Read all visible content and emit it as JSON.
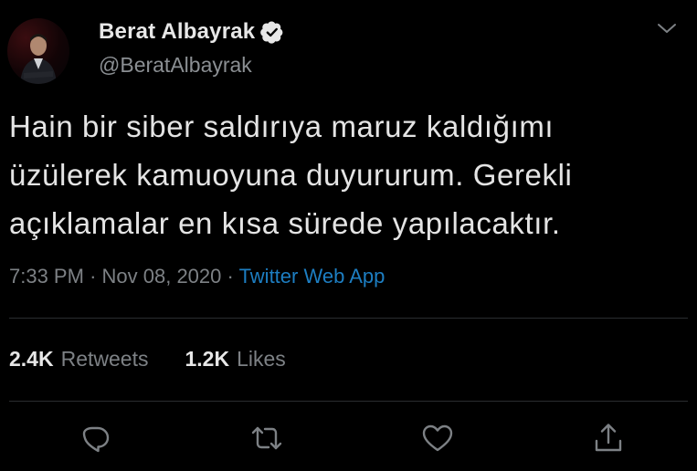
{
  "author": {
    "display_name": "Berat Albayrak",
    "handle": "@BeratAlbayrak",
    "verified": true
  },
  "tweet": {
    "text_lines": [
      "Hain bir siber saldırıya maruz kaldığımı",
      "üzülerek kamuoyuna duyururum. Gerekli",
      "açıklamalar en kısa sürede yapılacaktır."
    ]
  },
  "meta": {
    "time": "7:33 PM",
    "separator": "·",
    "date": "Nov 08, 2020",
    "source": "Twitter Web App"
  },
  "stats": {
    "retweets_count": "2.4K",
    "retweets_label": "Retweets",
    "likes_count": "1.2K",
    "likes_label": "Likes"
  },
  "icons": {
    "verified": "verified-badge-icon",
    "menu": "chevron-down-icon",
    "reply": "reply-icon",
    "retweet": "retweet-icon",
    "like": "heart-icon",
    "share": "share-icon"
  },
  "colors": {
    "background": "#000000",
    "link": "#1d7ec2",
    "muted": "#7d8185",
    "text": "#e4e4e4"
  }
}
